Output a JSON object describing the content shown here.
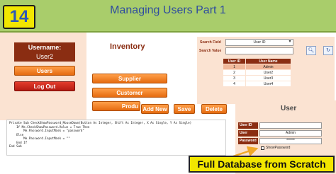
{
  "header": {
    "episode": "14",
    "title": "Managing Users Part 1"
  },
  "sidebar": {
    "username_label": "Username:",
    "username_value": "User2",
    "users_button": "Users",
    "logout_button": "Log Out"
  },
  "inventory": {
    "title": "Inventory",
    "supplier_button": "Supplier",
    "customer_button": "Customer",
    "product_button": "Produ"
  },
  "search": {
    "field_label": "Search Field",
    "field_value": "User ID",
    "value_label": "Search Value",
    "value": ""
  },
  "users_table": {
    "columns": [
      "User ID",
      "User Name"
    ],
    "rows": [
      [
        "1",
        "Admin"
      ],
      [
        "2",
        "User2"
      ],
      [
        "3",
        "User3"
      ],
      [
        "4",
        "User4"
      ]
    ],
    "selected_row": 0
  },
  "toolbar": {
    "add": "Add New",
    "save": "Save",
    "delete": "Delete"
  },
  "user_form": {
    "title": "User",
    "user_id_label": "User ID",
    "user_id_value": "",
    "user_name_label": "User Name",
    "user_name_value": "Admin",
    "password_label": "Password",
    "password_value": "******",
    "show_password": "ShowPassword"
  },
  "code": [
    "Private Sub CheckShowPassword_MouseDown(Button As Integer, Shift As Integer, X As Single, Y As Single)",
    "    If Me.CheckShowPassword.Value = True Then",
    "        Me.Password.InputMask = \"password\"",
    "",
    "    Else",
    "        Me.Password.InputMask = \"\"",
    "    End If",
    "End Sub"
  ],
  "banner": "Full Database from Scratch",
  "colors": {
    "header": "#a9cd6b",
    "panel": "#fbe3d2",
    "label_bg": "#8a2d12",
    "button": "#f07a1e",
    "banner": "#f2e600"
  }
}
